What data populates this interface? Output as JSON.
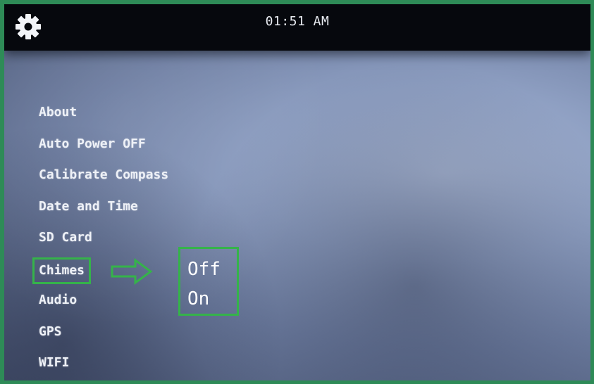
{
  "status_bar": {
    "settings_icon": "gear-icon",
    "time": "01:51 AM"
  },
  "menu": {
    "items": [
      {
        "label": "About"
      },
      {
        "label": "Auto Power OFF"
      },
      {
        "label": "Calibrate Compass"
      },
      {
        "label": "Date and Time"
      },
      {
        "label": "SD Card"
      },
      {
        "label": "Chimes"
      },
      {
        "label": "Audio"
      },
      {
        "label": "GPS"
      },
      {
        "label": "WIFI"
      }
    ],
    "selected": "Chimes"
  },
  "submenu": {
    "options": [
      {
        "label": "Off"
      },
      {
        "label": "On"
      }
    ]
  },
  "annotation": {
    "highlight_color": "#35b34a",
    "arrow_icon": "right-arrow-icon"
  },
  "colors": {
    "frame_border": "#2e8b57",
    "topbar_bg": "#06080d",
    "text": "#eef1f7"
  }
}
